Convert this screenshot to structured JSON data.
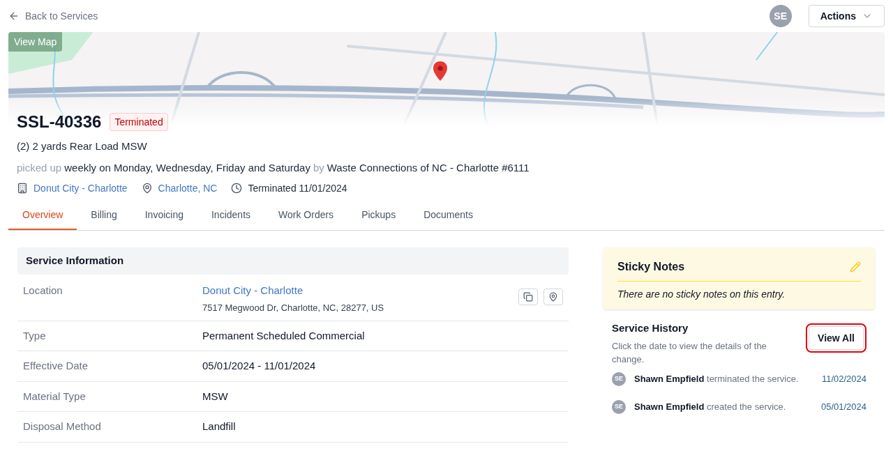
{
  "back_link": "Back to Services",
  "user_avatar": "SE",
  "actions_button": "Actions",
  "map": {
    "button": "View Map"
  },
  "service": {
    "id": "SSL-40336",
    "status": "Terminated",
    "description": "(2) 2 yards Rear Load MSW",
    "schedule": [
      {
        "text": "picked up",
        "kind": "muted"
      },
      {
        "text": "weekly on Monday, Wednesday, Friday and Saturday",
        "kind": "strong"
      },
      {
        "text": "by",
        "kind": "muted"
      },
      {
        "text": "Waste Connections of NC - Charlotte #6111",
        "kind": "strong"
      }
    ],
    "meta": [
      {
        "kind": "building",
        "text": "Donut City - Charlotte",
        "link": true
      },
      {
        "kind": "pin",
        "text": "Charlotte, NC",
        "link": true
      },
      {
        "kind": "clock",
        "text": "Terminated 11/01/2024",
        "link": false
      }
    ]
  },
  "tabs": [
    {
      "label": "Overview",
      "selected": true
    },
    {
      "label": "Billing",
      "selected": false
    },
    {
      "label": "Invoicing",
      "selected": false
    },
    {
      "label": "Incidents",
      "selected": false
    },
    {
      "label": "Work Orders",
      "selected": false
    },
    {
      "label": "Pickups",
      "selected": false
    },
    {
      "label": "Documents",
      "selected": false
    }
  ],
  "service_information": {
    "title": "Service Information",
    "rows": [
      {
        "label": "Location",
        "kind": "location",
        "value": "Donut City - Charlotte",
        "address": "7517 Megwood Dr, Charlotte, NC, 28277, US"
      },
      {
        "label": "Type",
        "kind": "text",
        "value": "Permanent Scheduled Commercial"
      },
      {
        "label": "Effective Date",
        "kind": "text",
        "value": "05/01/2024 - 11/01/2024"
      },
      {
        "label": "Material Type",
        "kind": "text",
        "value": "MSW"
      },
      {
        "label": "Disposal Method",
        "kind": "text",
        "value": "Landfill"
      }
    ]
  },
  "sticky_notes": {
    "title": "Sticky Notes",
    "empty_text": "There are no sticky notes on this entry."
  },
  "service_history": {
    "title": "Service History",
    "hint": "Click the date to view the details of the change.",
    "button": "View All",
    "button_highlighted": true,
    "entries": [
      {
        "avatar": "SE",
        "text": "**Shawn Empfield** terminated the service.",
        "date": "11/02/2024"
      },
      {
        "avatar": "SE",
        "text": "**Shawn Empfield** created the service.",
        "date": "05/01/2024"
      }
    ]
  }
}
